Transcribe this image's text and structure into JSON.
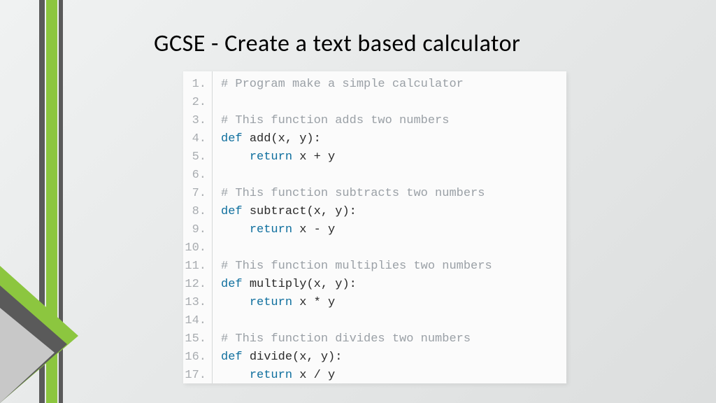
{
  "title": "GCSE - Create a text based calculator",
  "code_lines": [
    {
      "n": "1.",
      "tokens": [
        {
          "cls": "c-comment",
          "t": "# Program make a simple calculator"
        }
      ]
    },
    {
      "n": "2.",
      "tokens": [
        {
          "cls": "",
          "t": ""
        }
      ]
    },
    {
      "n": "3.",
      "tokens": [
        {
          "cls": "c-comment",
          "t": "# This function adds two numbers"
        }
      ]
    },
    {
      "n": "4.",
      "tokens": [
        {
          "cls": "c-key",
          "t": "def "
        },
        {
          "cls": "c-id",
          "t": "add"
        },
        {
          "cls": "c-punc",
          "t": "(x, y):"
        }
      ]
    },
    {
      "n": "5.",
      "tokens": [
        {
          "cls": "",
          "t": "    "
        },
        {
          "cls": "c-key",
          "t": "return "
        },
        {
          "cls": "c-id",
          "t": "x + y"
        }
      ]
    },
    {
      "n": "6.",
      "tokens": [
        {
          "cls": "",
          "t": ""
        }
      ]
    },
    {
      "n": "7.",
      "tokens": [
        {
          "cls": "c-comment",
          "t": "# This function subtracts two numbers"
        }
      ]
    },
    {
      "n": "8.",
      "tokens": [
        {
          "cls": "c-key",
          "t": "def "
        },
        {
          "cls": "c-id",
          "t": "subtract"
        },
        {
          "cls": "c-punc",
          "t": "(x, y):"
        }
      ]
    },
    {
      "n": "9.",
      "tokens": [
        {
          "cls": "",
          "t": "    "
        },
        {
          "cls": "c-key",
          "t": "return "
        },
        {
          "cls": "c-id",
          "t": "x - y"
        }
      ]
    },
    {
      "n": "10.",
      "tokens": [
        {
          "cls": "",
          "t": ""
        }
      ]
    },
    {
      "n": "11.",
      "tokens": [
        {
          "cls": "c-comment",
          "t": "# This function multiplies two numbers"
        }
      ]
    },
    {
      "n": "12.",
      "tokens": [
        {
          "cls": "c-key",
          "t": "def "
        },
        {
          "cls": "c-id",
          "t": "multiply"
        },
        {
          "cls": "c-punc",
          "t": "(x, y):"
        }
      ]
    },
    {
      "n": "13.",
      "tokens": [
        {
          "cls": "",
          "t": "    "
        },
        {
          "cls": "c-key",
          "t": "return "
        },
        {
          "cls": "c-id",
          "t": "x * y"
        }
      ]
    },
    {
      "n": "14.",
      "tokens": [
        {
          "cls": "",
          "t": ""
        }
      ]
    },
    {
      "n": "15.",
      "tokens": [
        {
          "cls": "c-comment",
          "t": "# This function divides two numbers"
        }
      ]
    },
    {
      "n": "16.",
      "tokens": [
        {
          "cls": "c-key",
          "t": "def "
        },
        {
          "cls": "c-id",
          "t": "divide"
        },
        {
          "cls": "c-punc",
          "t": "(x, y):"
        }
      ]
    },
    {
      "n": "17.",
      "tokens": [
        {
          "cls": "",
          "t": "    "
        },
        {
          "cls": "c-key",
          "t": "return "
        },
        {
          "cls": "c-id",
          "t": "x / y"
        }
      ]
    }
  ]
}
